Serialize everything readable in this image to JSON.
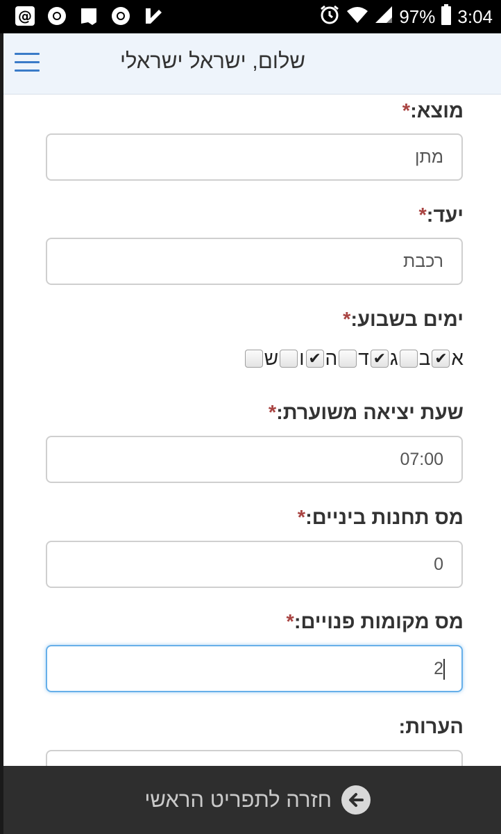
{
  "status_bar": {
    "battery": "97%",
    "time": "3:04",
    "icons": [
      "email-icon",
      "chrome-icon",
      "map-icon",
      "chrome-icon",
      "check-icon",
      "alarm-icon",
      "wifi-icon",
      "signal-icon",
      "battery-icon"
    ]
  },
  "header": {
    "greeting": "שלום, ישראל ישראלי",
    "menu_icon": "hamburger-menu-icon",
    "accent_color": "#3a7bc8"
  },
  "form": {
    "required_mark": "*",
    "origin": {
      "label": "מוצא:",
      "value": "מתן"
    },
    "destination": {
      "label": "יעד:",
      "value": "רכבת"
    },
    "days": {
      "label": "ימים בשבוע:",
      "items": [
        {
          "name": "א",
          "checked": true,
          "mark": "✔"
        },
        {
          "name": "ב",
          "checked": false,
          "mark": ""
        },
        {
          "name": "ג",
          "checked": true,
          "mark": "✔"
        },
        {
          "name": "ד",
          "checked": false,
          "mark": ""
        },
        {
          "name": "ה",
          "checked": true,
          "mark": "✔"
        },
        {
          "name": "ו",
          "checked": false,
          "mark": ""
        },
        {
          "name": "ש",
          "checked": false,
          "mark": ""
        }
      ]
    },
    "departure_time": {
      "label": "שעת יציאה משוערת:",
      "value": "07:00"
    },
    "stops": {
      "label": "מס תחנות ביניים:",
      "value": "0"
    },
    "seats": {
      "label": "מס מקומות פנויים:",
      "value": "2"
    },
    "notes": {
      "label": "הערות:",
      "value": ""
    }
  },
  "footer": {
    "back_label": "חזרה לתפריט הראשי",
    "back_icon": "arrow-left-circle-icon"
  }
}
